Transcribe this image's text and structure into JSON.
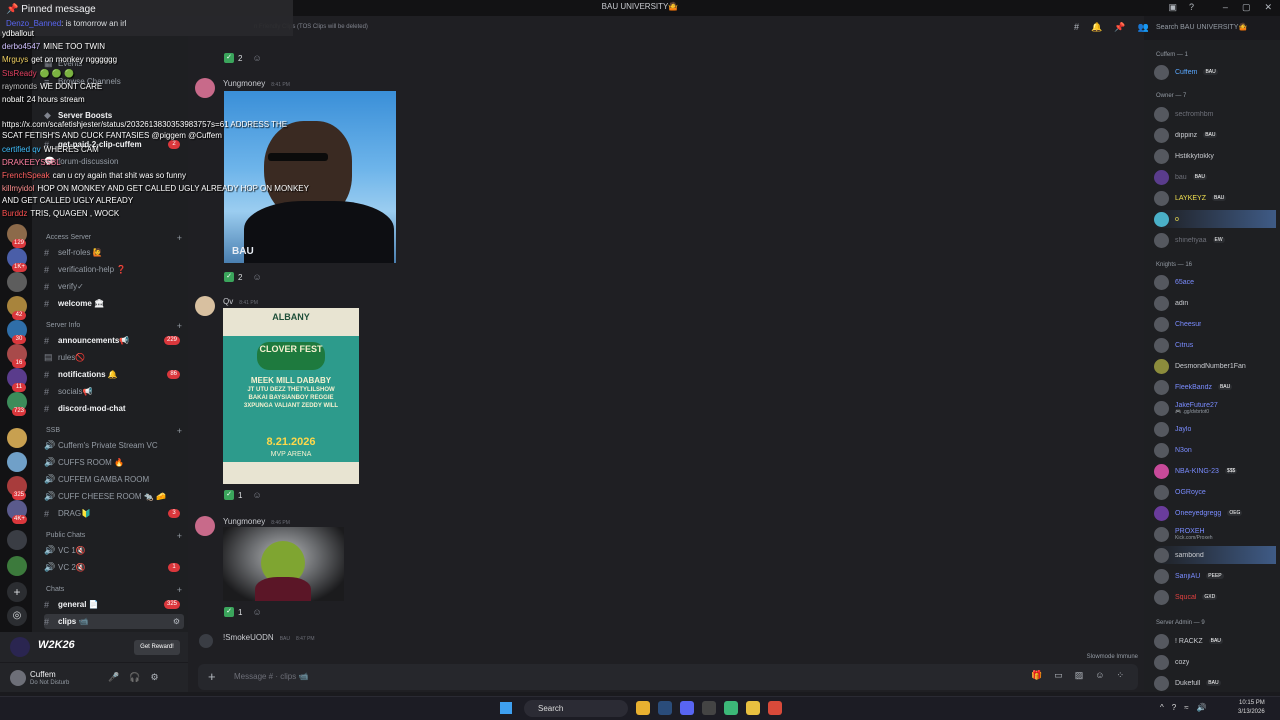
{
  "window": {
    "title": "BAU UNIVERSITY🤷"
  },
  "pinned": {
    "title": "Pinned message",
    "author": "Denzo_Banned",
    "text": "is tomorrow an irl"
  },
  "overlay_chat": [
    {
      "user": "ydballout",
      "text": "",
      "color": "#ffffff"
    },
    {
      "user": "derbo4547",
      "text": "MINE TOO TWIN",
      "color": "#d0c0ff"
    },
    {
      "user": "Mrguys",
      "text": "get on monkey ngggggg",
      "color": "#f0d060"
    },
    {
      "user": "StsReady",
      "text": "🟢 🟢 🟢",
      "color": "#e04060"
    },
    {
      "user": "raymonds",
      "text": "WE DONT CARE",
      "color": "#c0c0c0"
    },
    {
      "user": "nobalt",
      "text": "24 hours stream",
      "color": "#ffffff"
    },
    {
      "user": "",
      "text": "https://x.com/scafetishjester/status/2032613830353983757s=61  ADDRESS THE",
      "color": "#ffffff"
    },
    {
      "user": "",
      "text": "SCAT FETISH'S AND CUCK FANTASIES @piggem @Cuffem",
      "color": "#ffffff"
    },
    {
      "user": "certified qv",
      "text": "WHERES CAM",
      "color": "#40c0ff"
    },
    {
      "user": "DRAKEEYSSBL",
      "text": "",
      "color": "#ff80a0"
    },
    {
      "user": "FrenchSpeak",
      "text": "can u cry again that shit was so funny",
      "color": "#ff6060"
    },
    {
      "user": "killmyidol",
      "text": "HOP ON MONKEY AND GET CALLED UGLY ALREADY HOP ON MONKEY",
      "color": "#ff9090"
    },
    {
      "user": "",
      "text": "AND GET CALLED UGLY ALREADY",
      "color": "#ffffff"
    },
    {
      "user": "Burddz",
      "text": "TRIS, QUAGEN , WOCK",
      "color": "#ff5050"
    }
  ],
  "rail": {
    "badges": [
      "129",
      "1K+",
      "42",
      "3",
      "30",
      "16",
      "11",
      "723",
      "325",
      "4K+"
    ]
  },
  "sidebar": {
    "channels_top": [
      {
        "label": "Events"
      },
      {
        "label": "Browse Channels"
      },
      {
        "label": "Server Boosts",
        "badge": "4"
      },
      {
        "label": "get-paid-2-clip-cuffem",
        "badge": "2"
      },
      {
        "label": "forum-discussion"
      }
    ],
    "cat_access": "Access Server",
    "access": [
      {
        "label": "self-roles 🙋"
      },
      {
        "label": "verification-help ❓"
      },
      {
        "label": "verify✓"
      },
      {
        "label": "welcome 🏛",
        "bold": true
      }
    ],
    "cat_info": "Server Info",
    "info": [
      {
        "label": "announcements📢",
        "bold": true,
        "badge": "229"
      },
      {
        "label": "rules🚫"
      },
      {
        "label": "notifications 🔔",
        "bold": true,
        "badge": "86"
      },
      {
        "label": "socials📢"
      },
      {
        "label": "discord-mod-chat",
        "bold": true
      }
    ],
    "cat_ssb": "SSB",
    "ssb": [
      {
        "label": "Cuffem's Private Stream VC"
      },
      {
        "label": "CUFFS ROOM 🔥"
      },
      {
        "label": "CUFFEM GAMBA ROOM"
      },
      {
        "label": "CUFF CHEESE ROOM 🐀 🧀"
      },
      {
        "label": "DRAG🔰",
        "badge": "3"
      }
    ],
    "cat_public": "Public Chats",
    "public": [
      {
        "label": "VC 1🔇"
      },
      {
        "label": "VC 2🔇",
        "badge": "1"
      }
    ],
    "cat_chats": "Chats",
    "chats": [
      {
        "label": "general 📄",
        "bold": true,
        "badge": "325"
      },
      {
        "label": "clips 📹",
        "bold": true,
        "active": true
      }
    ]
  },
  "promo": {
    "logo": "W2K26",
    "button": "Get Reward!"
  },
  "user": {
    "name": "Cuffem",
    "status": "Do Not Disturb"
  },
  "chat": {
    "topic": "n Friendly Clips (TOS Clips will be deleted)",
    "messages": [
      {
        "author": "Yungmoney",
        "time": "8:41 PM",
        "reactions": "2"
      },
      {
        "author": "Qv",
        "time": "8:41 PM",
        "reactions": "1"
      },
      {
        "author": "Yungmoney",
        "time": "8:46 PM",
        "reactions": "1"
      },
      {
        "author": "!SmokeUODN",
        "tag": "BAU",
        "time": "8:47 PM"
      }
    ],
    "first_reaction": "2",
    "image1_watermark": "BAU",
    "poster": {
      "top": "ALBANY",
      "title": "CLOVER FEST",
      "line1": "MEEK MILL DABABY",
      "line2": "JT UTU DEZZ THETYLILSHOW",
      "line3": "BAKAI BAYSIANBOY REGGIE",
      "line4": "3XPUNGA VALIANT ZEDDY WILL",
      "date": "8.21.2026",
      "venue": "MVP ARENA"
    },
    "placeholder": "Message # · clips 📹",
    "slowmode": "Slowmode Immune"
  },
  "search": {
    "placeholder": "Search BAU UNIVERSITY🤷"
  },
  "members": {
    "groups": [
      {
        "title": "Cuffem — 1"
      },
      {
        "title": "Owner — 7"
      },
      {
        "title": "Knights — 16"
      },
      {
        "title": "Server Admin — 9"
      }
    ],
    "cuffem": [
      {
        "name": "Cuffem",
        "tag": "BAU",
        "color": "#5aa8ff"
      }
    ],
    "owner": [
      {
        "name": "secfromhbm",
        "color": "#6d6f78"
      },
      {
        "name": "dippinz",
        "tag": "BAU",
        "color": "#c9cbd0"
      },
      {
        "name": "Hstikkytokky",
        "color": "#c9cbd0"
      },
      {
        "name": "bau",
        "tag": "BAU",
        "color": "#6d6f78"
      },
      {
        "name": "LAYKEYZ",
        "tag": "BAU",
        "color": "#f0e050"
      },
      {
        "name": "o",
        "color": "#f0e050",
        "highlight": true
      },
      {
        "name": "shinefiyaa",
        "tag": "EW",
        "color": "#6d6f78"
      }
    ],
    "knights": [
      {
        "name": "65ace",
        "color": "#7a8cff"
      },
      {
        "name": "adin",
        "color": "#c9cbd0"
      },
      {
        "name": "Cheesur",
        "color": "#7a8cff"
      },
      {
        "name": "Citrus",
        "color": "#7a8cff"
      },
      {
        "name": "DesmondNumber1Fan",
        "color": "#c9cbd0"
      },
      {
        "name": "FleekBandz",
        "tag": "BAU",
        "color": "#7a8cff"
      },
      {
        "name": "JakeFuture27",
        "sub": "🎮 .gg/dvbrtot0",
        "color": "#7a8cff"
      },
      {
        "name": "Jaylo",
        "color": "#7a8cff"
      },
      {
        "name": "N3on",
        "color": "#7a8cff"
      },
      {
        "name": "NBA-KING-23",
        "tag": "$$$",
        "color": "#7a8cff"
      },
      {
        "name": "OGRoyce",
        "color": "#7a8cff"
      },
      {
        "name": "Oneeyedgregg",
        "tag": "OEG",
        "color": "#7a8cff"
      },
      {
        "name": "PROXEH",
        "sub": "Kick.com/Proxeh",
        "color": "#7a8cff"
      },
      {
        "name": "sambond",
        "color": "#c9cbd0",
        "highlight": true
      },
      {
        "name": "SanjiAU",
        "tag": "PEEP",
        "color": "#7a8cff"
      },
      {
        "name": "Squcal",
        "tag": "GXD",
        "color": "#e04040"
      }
    ],
    "admin": [
      {
        "name": "! RACKZ",
        "tag": "BAU",
        "color": "#c9cbd0"
      },
      {
        "name": "cozy",
        "color": "#c9cbd0"
      },
      {
        "name": "Dukefull",
        "tag": "BAU",
        "color": "#c9cbd0"
      }
    ]
  },
  "taskbar": {
    "search": "Search",
    "time": "10:15 PM",
    "date": "3/13/2026"
  }
}
